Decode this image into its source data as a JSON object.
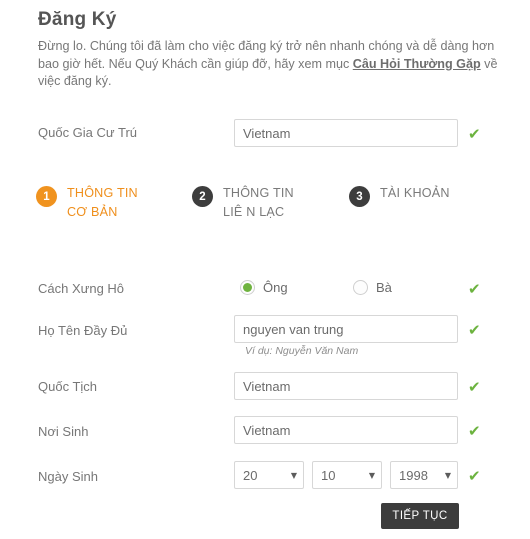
{
  "header": {
    "title": "Đăng Ký",
    "intro_before": "Đừng lo. Chúng tôi đã làm cho việc đăng ký trở nên nhanh chóng và dễ dàng hơn bao giờ hết. Nếu Quý Khách cần giúp đỡ, hãy xem mục ",
    "intro_link": "Câu Hỏi Thường Gặp",
    "intro_after": " về việc đăng ký."
  },
  "colors": {
    "accent_orange": "#f0931f",
    "step_idle": "#3d3d3d",
    "valid_green": "#6cb33f",
    "button_dark": "#3c3c3c",
    "label_gray": "#777777",
    "border_gray": "#d7d7d7"
  },
  "residence": {
    "label": "Quốc Gia Cư Trú",
    "value": "Vietnam",
    "placeholder": "Quốc Gia Cư Trú",
    "valid_icon": "✔"
  },
  "steps": [
    {
      "number": "1",
      "label": "THÔNG TIN CƠ BẢN",
      "state": "active"
    },
    {
      "number": "2",
      "label": "THÔNG TIN LIÊ N LẠC",
      "state": "idle"
    },
    {
      "number": "3",
      "label": "TÀI KHOẢN",
      "state": "idle"
    }
  ],
  "salutation": {
    "label": "Cách Xưng Hô",
    "options": [
      {
        "label": "Ông",
        "selected": true
      },
      {
        "label": "Bà",
        "selected": false
      }
    ],
    "valid_icon": "✔"
  },
  "fullname": {
    "label": "Họ Tên Đầy Đủ",
    "value": "nguyen van trung",
    "placeholder": "Họ Tên Đầy Đủ",
    "hint": "Ví dụ: Nguyễn Văn Nam",
    "valid_icon": "✔"
  },
  "nationality": {
    "label": "Quốc Tịch",
    "value": "Vietnam",
    "placeholder": "Quốc Tịch",
    "valid_icon": "✔"
  },
  "birthplace": {
    "label": "Nơi Sinh",
    "value": "Vietnam",
    "placeholder": "Nơi Sinh",
    "valid_icon": "✔"
  },
  "birthdate": {
    "label": "Ngày Sinh",
    "day": "20",
    "month": "10",
    "year": "1998",
    "arrow_icon": "▼",
    "valid_icon": "✔"
  },
  "submit": {
    "label": "TIẾP TỤC"
  }
}
